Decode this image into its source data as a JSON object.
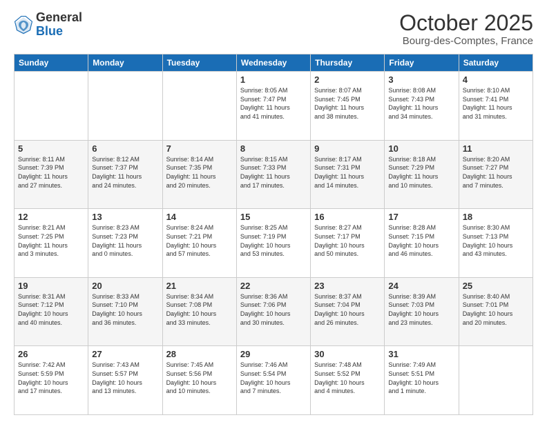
{
  "logo": {
    "general": "General",
    "blue": "Blue"
  },
  "header": {
    "month": "October 2025",
    "location": "Bourg-des-Comptes, France"
  },
  "days_of_week": [
    "Sunday",
    "Monday",
    "Tuesday",
    "Wednesday",
    "Thursday",
    "Friday",
    "Saturday"
  ],
  "weeks": [
    [
      {
        "num": "",
        "info": ""
      },
      {
        "num": "",
        "info": ""
      },
      {
        "num": "",
        "info": ""
      },
      {
        "num": "1",
        "info": "Sunrise: 8:05 AM\nSunset: 7:47 PM\nDaylight: 11 hours\nand 41 minutes."
      },
      {
        "num": "2",
        "info": "Sunrise: 8:07 AM\nSunset: 7:45 PM\nDaylight: 11 hours\nand 38 minutes."
      },
      {
        "num": "3",
        "info": "Sunrise: 8:08 AM\nSunset: 7:43 PM\nDaylight: 11 hours\nand 34 minutes."
      },
      {
        "num": "4",
        "info": "Sunrise: 8:10 AM\nSunset: 7:41 PM\nDaylight: 11 hours\nand 31 minutes."
      }
    ],
    [
      {
        "num": "5",
        "info": "Sunrise: 8:11 AM\nSunset: 7:39 PM\nDaylight: 11 hours\nand 27 minutes."
      },
      {
        "num": "6",
        "info": "Sunrise: 8:12 AM\nSunset: 7:37 PM\nDaylight: 11 hours\nand 24 minutes."
      },
      {
        "num": "7",
        "info": "Sunrise: 8:14 AM\nSunset: 7:35 PM\nDaylight: 11 hours\nand 20 minutes."
      },
      {
        "num": "8",
        "info": "Sunrise: 8:15 AM\nSunset: 7:33 PM\nDaylight: 11 hours\nand 17 minutes."
      },
      {
        "num": "9",
        "info": "Sunrise: 8:17 AM\nSunset: 7:31 PM\nDaylight: 11 hours\nand 14 minutes."
      },
      {
        "num": "10",
        "info": "Sunrise: 8:18 AM\nSunset: 7:29 PM\nDaylight: 11 hours\nand 10 minutes."
      },
      {
        "num": "11",
        "info": "Sunrise: 8:20 AM\nSunset: 7:27 PM\nDaylight: 11 hours\nand 7 minutes."
      }
    ],
    [
      {
        "num": "12",
        "info": "Sunrise: 8:21 AM\nSunset: 7:25 PM\nDaylight: 11 hours\nand 3 minutes."
      },
      {
        "num": "13",
        "info": "Sunrise: 8:23 AM\nSunset: 7:23 PM\nDaylight: 11 hours\nand 0 minutes."
      },
      {
        "num": "14",
        "info": "Sunrise: 8:24 AM\nSunset: 7:21 PM\nDaylight: 10 hours\nand 57 minutes."
      },
      {
        "num": "15",
        "info": "Sunrise: 8:25 AM\nSunset: 7:19 PM\nDaylight: 10 hours\nand 53 minutes."
      },
      {
        "num": "16",
        "info": "Sunrise: 8:27 AM\nSunset: 7:17 PM\nDaylight: 10 hours\nand 50 minutes."
      },
      {
        "num": "17",
        "info": "Sunrise: 8:28 AM\nSunset: 7:15 PM\nDaylight: 10 hours\nand 46 minutes."
      },
      {
        "num": "18",
        "info": "Sunrise: 8:30 AM\nSunset: 7:13 PM\nDaylight: 10 hours\nand 43 minutes."
      }
    ],
    [
      {
        "num": "19",
        "info": "Sunrise: 8:31 AM\nSunset: 7:12 PM\nDaylight: 10 hours\nand 40 minutes."
      },
      {
        "num": "20",
        "info": "Sunrise: 8:33 AM\nSunset: 7:10 PM\nDaylight: 10 hours\nand 36 minutes."
      },
      {
        "num": "21",
        "info": "Sunrise: 8:34 AM\nSunset: 7:08 PM\nDaylight: 10 hours\nand 33 minutes."
      },
      {
        "num": "22",
        "info": "Sunrise: 8:36 AM\nSunset: 7:06 PM\nDaylight: 10 hours\nand 30 minutes."
      },
      {
        "num": "23",
        "info": "Sunrise: 8:37 AM\nSunset: 7:04 PM\nDaylight: 10 hours\nand 26 minutes."
      },
      {
        "num": "24",
        "info": "Sunrise: 8:39 AM\nSunset: 7:03 PM\nDaylight: 10 hours\nand 23 minutes."
      },
      {
        "num": "25",
        "info": "Sunrise: 8:40 AM\nSunset: 7:01 PM\nDaylight: 10 hours\nand 20 minutes."
      }
    ],
    [
      {
        "num": "26",
        "info": "Sunrise: 7:42 AM\nSunset: 5:59 PM\nDaylight: 10 hours\nand 17 minutes."
      },
      {
        "num": "27",
        "info": "Sunrise: 7:43 AM\nSunset: 5:57 PM\nDaylight: 10 hours\nand 13 minutes."
      },
      {
        "num": "28",
        "info": "Sunrise: 7:45 AM\nSunset: 5:56 PM\nDaylight: 10 hours\nand 10 minutes."
      },
      {
        "num": "29",
        "info": "Sunrise: 7:46 AM\nSunset: 5:54 PM\nDaylight: 10 hours\nand 7 minutes."
      },
      {
        "num": "30",
        "info": "Sunrise: 7:48 AM\nSunset: 5:52 PM\nDaylight: 10 hours\nand 4 minutes."
      },
      {
        "num": "31",
        "info": "Sunrise: 7:49 AM\nSunset: 5:51 PM\nDaylight: 10 hours\nand 1 minute."
      },
      {
        "num": "",
        "info": ""
      }
    ]
  ]
}
